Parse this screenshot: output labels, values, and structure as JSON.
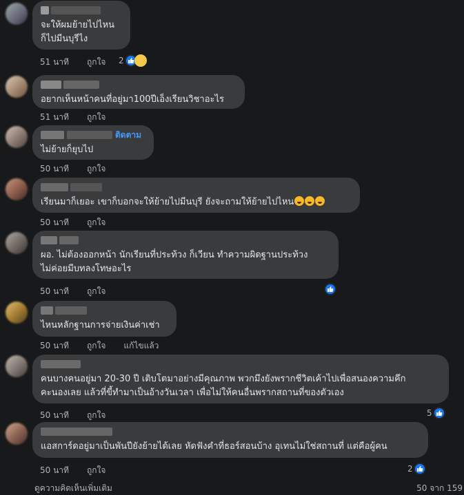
{
  "comments": [
    {
      "text1": "จะให้ผมย้ายไปไหน",
      "text2": "ก็ไปมีนบุรีไง",
      "time": "51 นาที",
      "like": "ถูกใจ",
      "reaction_count": "2"
    },
    {
      "text1": "อยากเห็นหน้าคนที่อยู่มา100ปีเอ็งเรียนวิชาอะไร",
      "time": "51 นาที",
      "like": "ถูกใจ"
    },
    {
      "follow": "ติดตาม",
      "text1": "ไม่ย้ายก็ยุบไป",
      "time": "50 นาที",
      "like": "ถูกใจ"
    },
    {
      "text1": "เรียนมาก็เยอะ เขาก็บอกจะให้ย้ายไปมีนบุรี ยังจะถามให้ย้ายไปไหน",
      "time": "50 นาที",
      "like": "ถูกใจ"
    },
    {
      "text1": "ผอ. ไม่ต้องออกหน้า นักเรียนที่ประท้วง ก็เวียน ทำความผิดฐานประท้วง",
      "text2": "ไม่ค่อยมีบทลงโทษอะไร",
      "time": "50 นาที",
      "like": "ถูกใจ"
    },
    {
      "text1": "ไหนหลักฐานการจ่ายเงินค่าเช่า",
      "time": "50 นาที",
      "like": "ถูกใจ",
      "edited": "แก้ไขแล้ว"
    },
    {
      "text1": "คนบางคนอยู่มา 20-30 ปี เติบโตมาอย่างมีคุณภาพ พวกมึงยังพรากชีวิตเค้าไปเพื่อสนองความคึก",
      "text2": "คะนองเลย แล้วที่ขี้ทำมาเป็นอ้างวันเวลา เพื่อไม่ให้คนอื่นพรากสถานที่ของตัวเอง",
      "time": "50 นาที",
      "like": "ถูกใจ",
      "reaction_count": "5"
    },
    {
      "text1": "แอสการ์ดอยู่มาเป็นพันปียังย้ายได้เลย หัดฟังคำที่ธอร์สอนบ้าง อุเทนไม่ใช่สถานที่ แต่คือผู้คน",
      "time": "50 นาที",
      "like": "ถูกใจ",
      "reaction_count": "2"
    }
  ],
  "footer": {
    "left": "ดูความคิดเห็นเพิ่มเติม",
    "right": "50 จาก 159"
  }
}
